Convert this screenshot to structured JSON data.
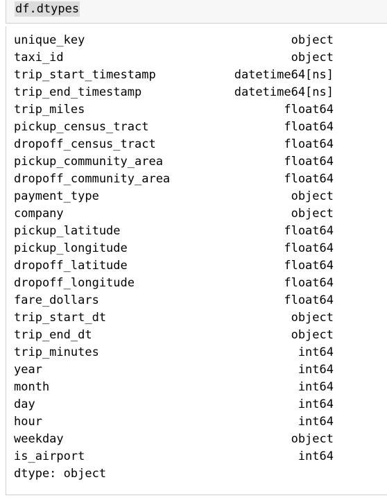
{
  "cell": {
    "code": "df.dtypes"
  },
  "output": {
    "rows": [
      {
        "name": "unique_key",
        "type": "object"
      },
      {
        "name": "taxi_id",
        "type": "object"
      },
      {
        "name": "trip_start_timestamp",
        "type": "datetime64[ns]"
      },
      {
        "name": "trip_end_timestamp",
        "type": "datetime64[ns]"
      },
      {
        "name": "trip_miles",
        "type": "float64"
      },
      {
        "name": "pickup_census_tract",
        "type": "float64"
      },
      {
        "name": "dropoff_census_tract",
        "type": "float64"
      },
      {
        "name": "pickup_community_area",
        "type": "float64"
      },
      {
        "name": "dropoff_community_area",
        "type": "float64"
      },
      {
        "name": "payment_type",
        "type": "object"
      },
      {
        "name": "company",
        "type": "object"
      },
      {
        "name": "pickup_latitude",
        "type": "float64"
      },
      {
        "name": "pickup_longitude",
        "type": "float64"
      },
      {
        "name": "dropoff_latitude",
        "type": "float64"
      },
      {
        "name": "dropoff_longitude",
        "type": "float64"
      },
      {
        "name": "fare_dollars",
        "type": "float64"
      },
      {
        "name": "trip_start_dt",
        "type": "object"
      },
      {
        "name": "trip_end_dt",
        "type": "object"
      },
      {
        "name": "trip_minutes",
        "type": "int64"
      },
      {
        "name": "year",
        "type": "int64"
      },
      {
        "name": "month",
        "type": "int64"
      },
      {
        "name": "day",
        "type": "int64"
      },
      {
        "name": "hour",
        "type": "int64"
      },
      {
        "name": "weekday",
        "type": "object"
      },
      {
        "name": "is_airport",
        "type": "int64"
      }
    ],
    "footer": "dtype: object"
  }
}
